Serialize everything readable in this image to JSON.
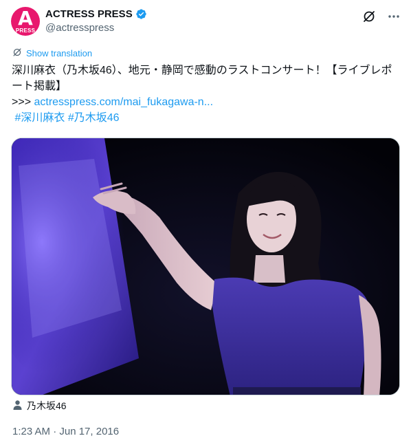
{
  "author": {
    "display_name": "ACTRESS PRESS",
    "handle": "@actresspress",
    "avatar_letter": "A",
    "avatar_subtext": "PRESS",
    "avatar_color": "#e8186d",
    "verified": true,
    "verified_color": "#1d9bf0"
  },
  "header_actions": {
    "grok_icon": "grok-slash-icon",
    "more_icon": "more-dots-icon"
  },
  "translation": {
    "label": "Show translation",
    "icon": "translate-icon"
  },
  "tweet": {
    "text_line": "深川麻衣（乃木坂46）、地元・静岡で感動のラストコンサート！【ライブレポート掲載】",
    "link_prefix": ">>> ",
    "link_text": "actresspress.com/mai_fukagawa-n...",
    "hashtag_1": "#深川麻衣",
    "hashtag_2": "#乃木坂46"
  },
  "media": {
    "icon": "photo"
  },
  "tagged": {
    "icon": "person-icon",
    "label": "乃木坂46"
  },
  "timestamp": "1:23 AM · Jun 17, 2016",
  "colors": {
    "link": "#1d9bf0",
    "secondary_text": "#536471",
    "primary_text": "#0f1419"
  }
}
